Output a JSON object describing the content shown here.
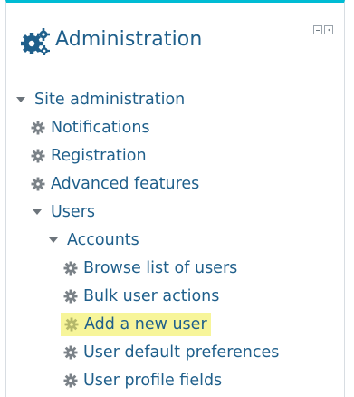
{
  "block": {
    "title": "Administration",
    "icon": "cogs-icon",
    "controls": [
      "hide-block",
      "dock-block"
    ]
  },
  "tree": {
    "site_admin": "Site administration",
    "notifications": "Notifications",
    "registration": "Registration",
    "advanced_features": "Advanced features",
    "users": "Users",
    "accounts": "Accounts",
    "browse_users": "Browse list of users",
    "bulk_actions": "Bulk user actions",
    "add_user": "Add a new user",
    "user_default_prefs": "User default preferences",
    "user_profile_fields": "User profile fields"
  },
  "colors": {
    "accent_top": "#00bcd4",
    "link": "#1f5f8b",
    "highlight": "#f7f59a"
  }
}
